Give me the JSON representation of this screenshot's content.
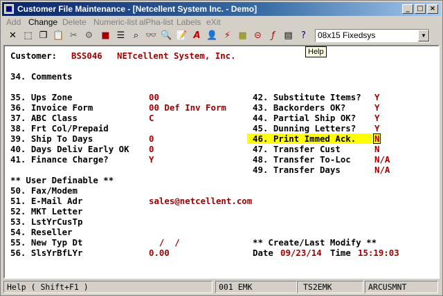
{
  "window": {
    "title": "Customer File Maintenance - [Netcellent System Inc. - Demo]"
  },
  "menu": {
    "items": [
      "Add",
      "Change",
      "Delete",
      "Numeric-list",
      "alPha-list",
      "Labels",
      "eXit"
    ]
  },
  "toolbar": {
    "font": "08x15 Fixedsys",
    "tooltip": "Help"
  },
  "customer": {
    "label": "Customer:",
    "number": "BSS046",
    "name": "NETcellent System, Inc."
  },
  "comments": "34. Comments",
  "left_fields": [
    {
      "label": "35. Ups Zone",
      "value": "00"
    },
    {
      "label": "36. Invoice Form",
      "value": "00 Def Inv Form"
    },
    {
      "label": "37. ABC Class",
      "value": "C"
    },
    {
      "label": "38. Frt Col/Prepaid",
      "value": ""
    },
    {
      "label": "39. Ship To Days",
      "value": "0"
    },
    {
      "label": "40. Days Deliv Early OK",
      "value": "0"
    },
    {
      "label": "41. Finance Charge?",
      "value": "Y"
    }
  ],
  "right_fields": [
    {
      "label": "42. Substitute Items?",
      "value": "Y"
    },
    {
      "label": "43. Backorders OK?",
      "value": "Y"
    },
    {
      "label": "44. Partial Ship OK?",
      "value": "Y"
    },
    {
      "label": "45. Dunning Letters?",
      "value": "Y"
    },
    {
      "label": "46. Print Immed Ack.",
      "value": "N"
    },
    {
      "label": "47. Transfer Cust",
      "value": "N"
    },
    {
      "label": "48. Transfer To-Loc",
      "value": "N/A"
    },
    {
      "label": "49. Transfer Days",
      "value": "N/A"
    }
  ],
  "user_definable": {
    "header": "** User Definable **",
    "fields": [
      {
        "label": "50. Fax/Modem",
        "value": ""
      },
      {
        "label": "51. E-Mail Adr",
        "value": "sales@netcellent.com"
      },
      {
        "label": "52. MKT Letter",
        "value": ""
      },
      {
        "label": "53. LstYrCusTp",
        "value": ""
      },
      {
        "label": "54. Reseller",
        "value": ""
      },
      {
        "label": "55. New Typ Dt",
        "value": "  /  /"
      },
      {
        "label": "56. SlsYrBfLYr",
        "value": "0.00"
      }
    ]
  },
  "create_modify": {
    "header": "** Create/Last Modify **",
    "date_label": "Date",
    "date": "09/23/14",
    "time_label": "Time",
    "time": "15:19:03"
  },
  "status": {
    "help": "Help ( Shift+F1 )",
    "user": "001 EMK",
    "terminal": "TS2EMK",
    "program": "ARCUSMNT"
  }
}
